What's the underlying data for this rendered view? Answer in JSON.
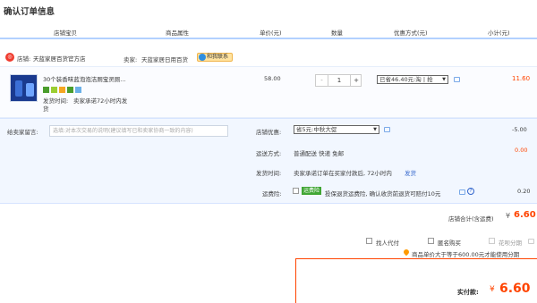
{
  "page": {
    "title": "确认订单信息"
  },
  "header": {
    "cols": [
      "店铺宝贝",
      "商品属性",
      "单价(元)",
      "数量",
      "优惠方式(元)",
      "小计(元)"
    ]
  },
  "shop": {
    "label": "店铺:",
    "name": "天蓝家居百货官方店",
    "seller_label": "卖家:",
    "seller": "天蓝家居日用百货",
    "contact": "和我联系"
  },
  "item": {
    "title": "30个装香味蓝泡泡洁厕宝灵厕...",
    "ship_time_label": "发货时间:",
    "ship_time_line1": "卖家承诺72小时内发",
    "ship_time_line2": "货",
    "price": "58.00",
    "qty": "1",
    "qty_minus": "-",
    "qty_plus": "+",
    "discount": "已省46.40元:淘 | 抢",
    "subtotal": "11.60"
  },
  "message": {
    "label": "给卖家留言:",
    "placeholder": "选填:对本次交易的说明(建议填写已和卖家协商一致的内容)"
  },
  "promo": {
    "label": "店铺优惠:",
    "value": "省5元:中秋大促",
    "amount": "-5.00"
  },
  "shipping": {
    "label": "运送方式:",
    "value": "普通配送 快递 免邮",
    "amount": "0.00"
  },
  "delivery": {
    "label": "发货时间:",
    "value": "卖家承诺订单在买家付款后, 72小时内",
    "link": "发货"
  },
  "insurance": {
    "label": "运费险:",
    "tag": "运费险",
    "value": "投保退货运费险, 确认收货前退货可赔付10元",
    "amount": "0.20"
  },
  "store_total": {
    "label": "店铺合计(含运费)",
    "currency": "¥",
    "value": "6.60"
  },
  "options": {
    "agent_pay": "找人代付",
    "anonymous": "匿名购买",
    "installment": "花呗分期",
    "installment_note": "商品单价大于等于600.00元才能使用分期"
  },
  "pay": {
    "label": "实付款:",
    "currency": "¥",
    "value": "6.60"
  },
  "colors": {
    "accent": "#ff4400",
    "link": "#3366cc",
    "header_line": "#b2d1ff"
  }
}
